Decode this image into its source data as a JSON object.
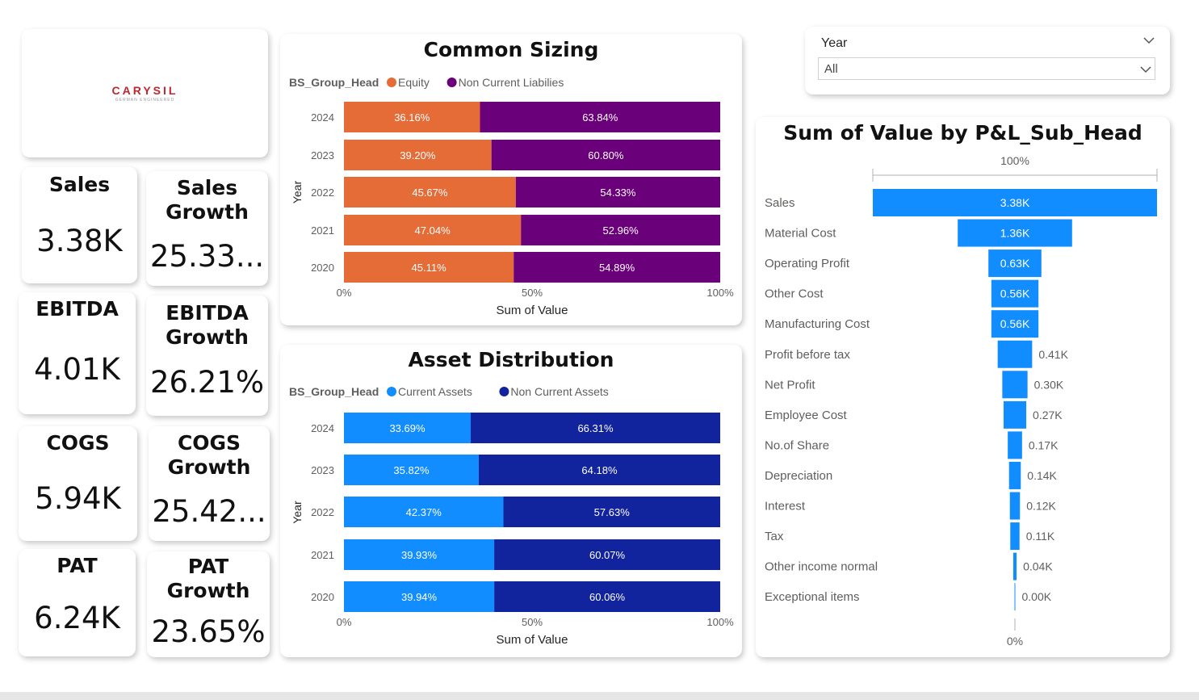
{
  "logo": {
    "name": "CARYSIL",
    "tagline": "GERMAN ENGINEERED"
  },
  "kpis": [
    {
      "label": "Sales",
      "value": "3.38K"
    },
    {
      "label": "Sales\nGrowth",
      "value": "25.33..."
    },
    {
      "label": "EBITDA",
      "value": "4.01K"
    },
    {
      "label": "EBITDA\nGrowth",
      "value": "26.21%"
    },
    {
      "label": "COGS",
      "value": "5.94K"
    },
    {
      "label": "COGS\nGrowth",
      "value": "25.42..."
    },
    {
      "label": "PAT",
      "value": "6.24K"
    },
    {
      "label": "PAT\nGrowth",
      "value": "23.65%"
    }
  ],
  "slicer": {
    "label": "Year",
    "value": "All",
    "icon": "chevron-down-icon"
  },
  "colors": {
    "equity": "#E66C37",
    "non_current_liabilities": "#6B007B",
    "current_assets": "#118DFF",
    "non_current_assets": "#12239E",
    "funnel": "#118DFF"
  },
  "chart_data": [
    {
      "type": "bar",
      "orientation": "horizontal",
      "stacked": "100%",
      "title": "Common Sizing",
      "legend_title": "BS_Group_Head",
      "legend_position": "top-left",
      "ylabel": "Year",
      "xlabel": "Sum of Value",
      "x_ticks": [
        "0%",
        "50%",
        "100%"
      ],
      "categories": [
        "2024",
        "2023",
        "2022",
        "2021",
        "2020"
      ],
      "series": [
        {
          "name": "Equity",
          "values": [
            36.16,
            39.2,
            45.67,
            47.04,
            45.11
          ],
          "labels": [
            "36.16%",
            "39.20%",
            "45.67%",
            "47.04%",
            "45.11%"
          ]
        },
        {
          "name": "Non Current Liabilies",
          "values": [
            63.84,
            60.8,
            54.33,
            52.96,
            54.89
          ],
          "labels": [
            "63.84%",
            "60.80%",
            "54.33%",
            "52.96%",
            "54.89%"
          ]
        }
      ]
    },
    {
      "type": "bar",
      "orientation": "horizontal",
      "stacked": "100%",
      "title": "Asset Distribution",
      "legend_title": "BS_Group_Head",
      "legend_position": "top-left",
      "ylabel": "Year",
      "xlabel": "Sum of Value",
      "x_ticks": [
        "0%",
        "50%",
        "100%"
      ],
      "categories": [
        "2024",
        "2023",
        "2022",
        "2021",
        "2020"
      ],
      "series": [
        {
          "name": "Current Assets",
          "values": [
            33.69,
            35.82,
            42.37,
            39.93,
            39.94
          ],
          "labels": [
            "33.69%",
            "35.82%",
            "42.37%",
            "39.93%",
            "39.94%"
          ]
        },
        {
          "name": "Non Current Assets",
          "values": [
            66.31,
            64.18,
            57.63,
            60.07,
            60.06
          ],
          "labels": [
            "66.31%",
            "64.18%",
            "57.63%",
            "60.07%",
            "60.06%"
          ]
        }
      ]
    },
    {
      "type": "bar",
      "subtype": "funnel",
      "title": "Sum of Value by P&L_Sub_Head",
      "top_label": "100%",
      "bottom_label": "0%",
      "categories": [
        "Sales",
        "Material Cost",
        "Operating Profit",
        "Other Cost",
        "Manufacturing Cost",
        "Profit before tax",
        "Net Profit",
        "Employee Cost",
        "No.of Share",
        "Depreciation",
        "Interest",
        "Tax",
        "Other income normal",
        "Exceptional items"
      ],
      "values": [
        3380,
        1360,
        630,
        560,
        560,
        410,
        300,
        270,
        170,
        140,
        120,
        110,
        40,
        0
      ],
      "labels": [
        "3.38K",
        "1.36K",
        "0.63K",
        "0.56K",
        "0.56K",
        "0.41K",
        "0.30K",
        "0.27K",
        "0.17K",
        "0.14K",
        "0.12K",
        "0.11K",
        "0.04K",
        "0.00K"
      ]
    }
  ]
}
